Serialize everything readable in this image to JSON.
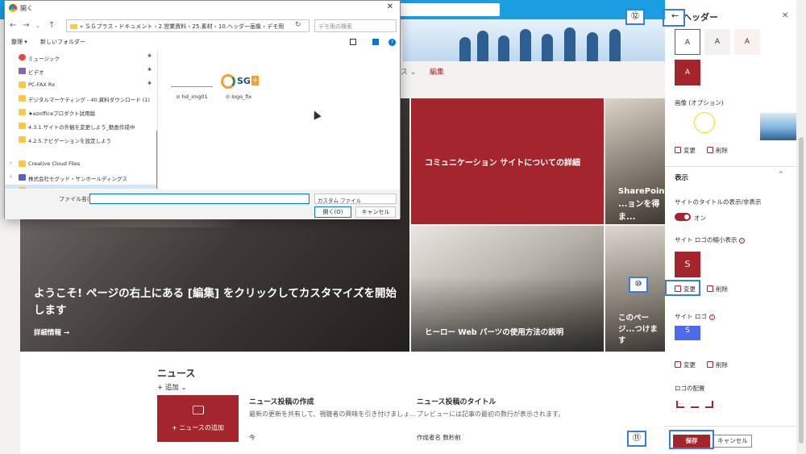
{
  "dialog": {
    "title": "開く",
    "path": "« ＳＧプラス・ドキュメント › 2.営業資料 › 25.素材 › 10.ヘッダー画像 › デモ用",
    "search_placeholder": "デモ用の検索",
    "toolbar_organize": "整理 ▾",
    "toolbar_new_folder": "新しいフォルダー",
    "sidebar": [
      {
        "label": "ミュージック",
        "pinned": true
      },
      {
        "label": "ビデオ",
        "pinned": true
      },
      {
        "label": "PC-FAX Rx",
        "pinned": true
      },
      {
        "label": "デジタルマーケティング - 40.資料ダウンロード (1)",
        "pinned": false
      },
      {
        "label": "★ezofficeプロダクト試用版",
        "pinned": false
      },
      {
        "label": "4.3.1.サイトの外観を変更しよう_動画作成中",
        "pinned": false
      },
      {
        "label": "4.2.5.ナビゲーションを設定しよう",
        "pinned": false
      },
      {
        "label": "Creative Cloud Files",
        "pinned": false
      },
      {
        "label": "株式会社セグッド・サンホールディングス",
        "pinned": false
      }
    ],
    "files": [
      {
        "name": "hd_img01"
      },
      {
        "name": "logo_fix"
      }
    ],
    "filename_label": "ファイル名(N):",
    "filetype": "カスタム ファイル",
    "open_button": "開く(O)",
    "cancel_button": "キャンセル"
  },
  "site": {
    "nav_more": "ス ⌄",
    "nav_edit": "編集",
    "hero": {
      "main_caption": "ようこそ! ページの右上にある [編集] をクリックしてカスタマイズを開始します",
      "main_link": "詳細情報 →",
      "red_caption": "コミュニケーション サイトについての詳細",
      "sp_caption": "SharePoint ...ョンを得ま...",
      "arch_caption": "ヒーロー Web パーツの使用方法の説明",
      "last_caption": "このページ...つけます"
    },
    "news": {
      "title": "ニュース",
      "add": "+ 追加 ⌄",
      "tile_label": "+ ニュースの追加",
      "item1_title": "ニュース投稿の作成",
      "item1_desc": "最新の更新を共有して、視聴者の興味を引き付けましょ...",
      "item1_meta": "今",
      "item2_title": "ニュース投稿のタイトル",
      "item2_desc": "プレビューには記事の最初の数行が表示されます。",
      "item2_meta": "作成者名 数秒前"
    }
  },
  "panel": {
    "back": "←",
    "title": "ヘッダー",
    "close": "✕",
    "theme_glyph": "A",
    "image_label": "画像 (オプション)",
    "change": "変更",
    "delete": "削除",
    "display_section": "表示",
    "show_title_label": "サイトのタイトルの表示/非表示",
    "toggle_on": "オン",
    "small_logo_label": "サイト ロゴの縮小表示",
    "small_logo_letter": "S",
    "site_logo_label": "サイト ロゴ",
    "logo_align_label": "ロゴの配置",
    "save": "保存",
    "cancel": "キャンセル"
  },
  "callouts": {
    "c10": "⑩",
    "c11": "⑪",
    "c12": "⑫"
  },
  "colors": {
    "accent": "#a4262c",
    "suite_bar": "#1b9de2",
    "callout": "#3b7dd8"
  }
}
